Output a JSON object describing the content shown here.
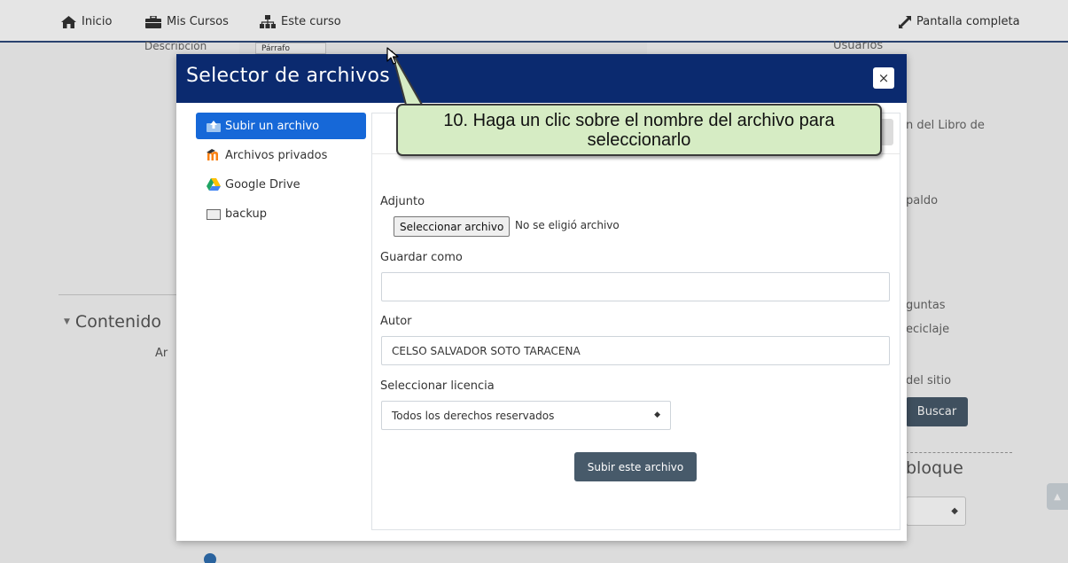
{
  "nav": {
    "home": "Inicio",
    "my_courses": "Mis Cursos",
    "this_course": "Este curso",
    "fullscreen": "Pantalla completa"
  },
  "background": {
    "description_label": "Descripción",
    "editor_format": "Párrafo",
    "users_link": "Usuarios",
    "book_fragment": "n del Libro de",
    "backup_fragment": "paldo",
    "content_heading": "Contenido",
    "ar_fragment": "Ar",
    "questions_fragment": "guntas",
    "recycle_fragment": "eciclaje",
    "site_fragment": "del sitio",
    "search_button": "Buscar",
    "block_heading": "bloque"
  },
  "modal": {
    "title": "Selector de archivos",
    "close_symbol": "×",
    "repositories": [
      {
        "label": "Subir un archivo",
        "icon": "upload-icon",
        "active": true
      },
      {
        "label": "Archivos privados",
        "icon": "moodle-icon",
        "active": false
      },
      {
        "label": "Google Drive",
        "icon": "google-drive-icon",
        "active": false
      },
      {
        "label": "backup",
        "icon": "folder-icon",
        "active": false
      }
    ],
    "attachment_label": "Adjunto",
    "choose_file_button": "Seleccionar archivo",
    "no_file_text": "No se eligió archivo",
    "save_as_label": "Guardar como",
    "save_as_value": "",
    "author_label": "Autor",
    "author_value": "CELSO SALVADOR SOTO TARACENA",
    "license_label": "Seleccionar licencia",
    "license_value": "Todos los derechos reservados",
    "upload_button": "Subir este archivo"
  },
  "callout": {
    "text": "10. Haga un clic sobre el nombre del archivo para seleccionarlo"
  },
  "colors": {
    "modal_header": "#0b2a6f",
    "active_item": "#1668d8",
    "primary_button": "#475a6a",
    "callout_bg": "#d6ecc4"
  }
}
